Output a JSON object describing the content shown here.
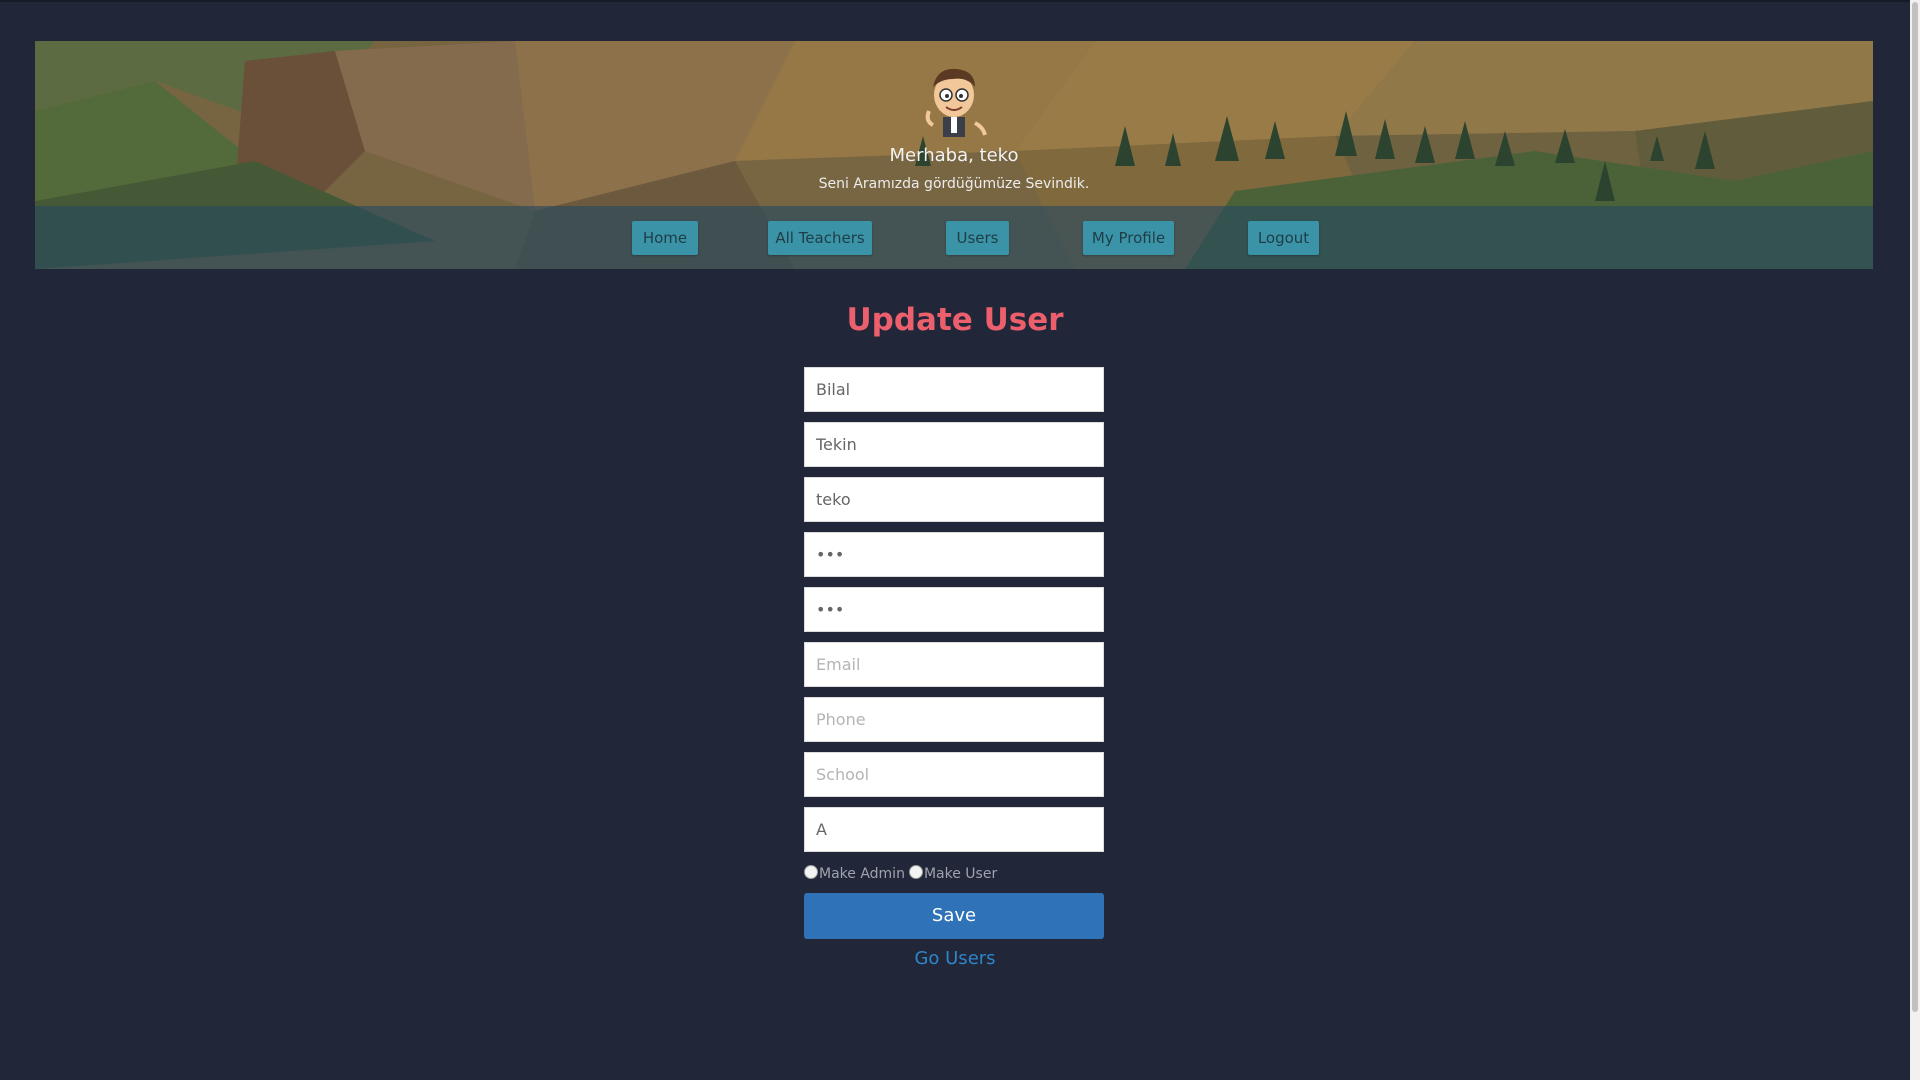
{
  "header": {
    "greeting": "Merhaba, teko",
    "welcome": "Seni Aramızda gördüğümüze Sevindik."
  },
  "nav": {
    "items": [
      {
        "label": "Home"
      },
      {
        "label": "All Teachers"
      },
      {
        "label": "Users"
      },
      {
        "label": "My Profile"
      },
      {
        "label": "Logout"
      }
    ]
  },
  "form": {
    "title": "Update User",
    "fields": [
      {
        "value": "Bilal",
        "placeholder": ""
      },
      {
        "value": "Tekin",
        "placeholder": ""
      },
      {
        "value": "teko",
        "placeholder": ""
      },
      {
        "value": "•••",
        "placeholder": ""
      },
      {
        "value": "•••",
        "placeholder": ""
      },
      {
        "value": "",
        "placeholder": "Email"
      },
      {
        "value": "",
        "placeholder": "Phone"
      },
      {
        "value": "",
        "placeholder": "School"
      },
      {
        "value": "A",
        "placeholder": ""
      }
    ],
    "radio_admin_label": "Make Admin",
    "radio_user_label": "Make User",
    "save_label": "Save",
    "go_users_label": "Go Users"
  },
  "colors": {
    "background": "#212739",
    "title": "#ec5f6c",
    "nav_button": "#3b93a7",
    "save_button": "#2f72b8",
    "link": "#2f85c9"
  }
}
